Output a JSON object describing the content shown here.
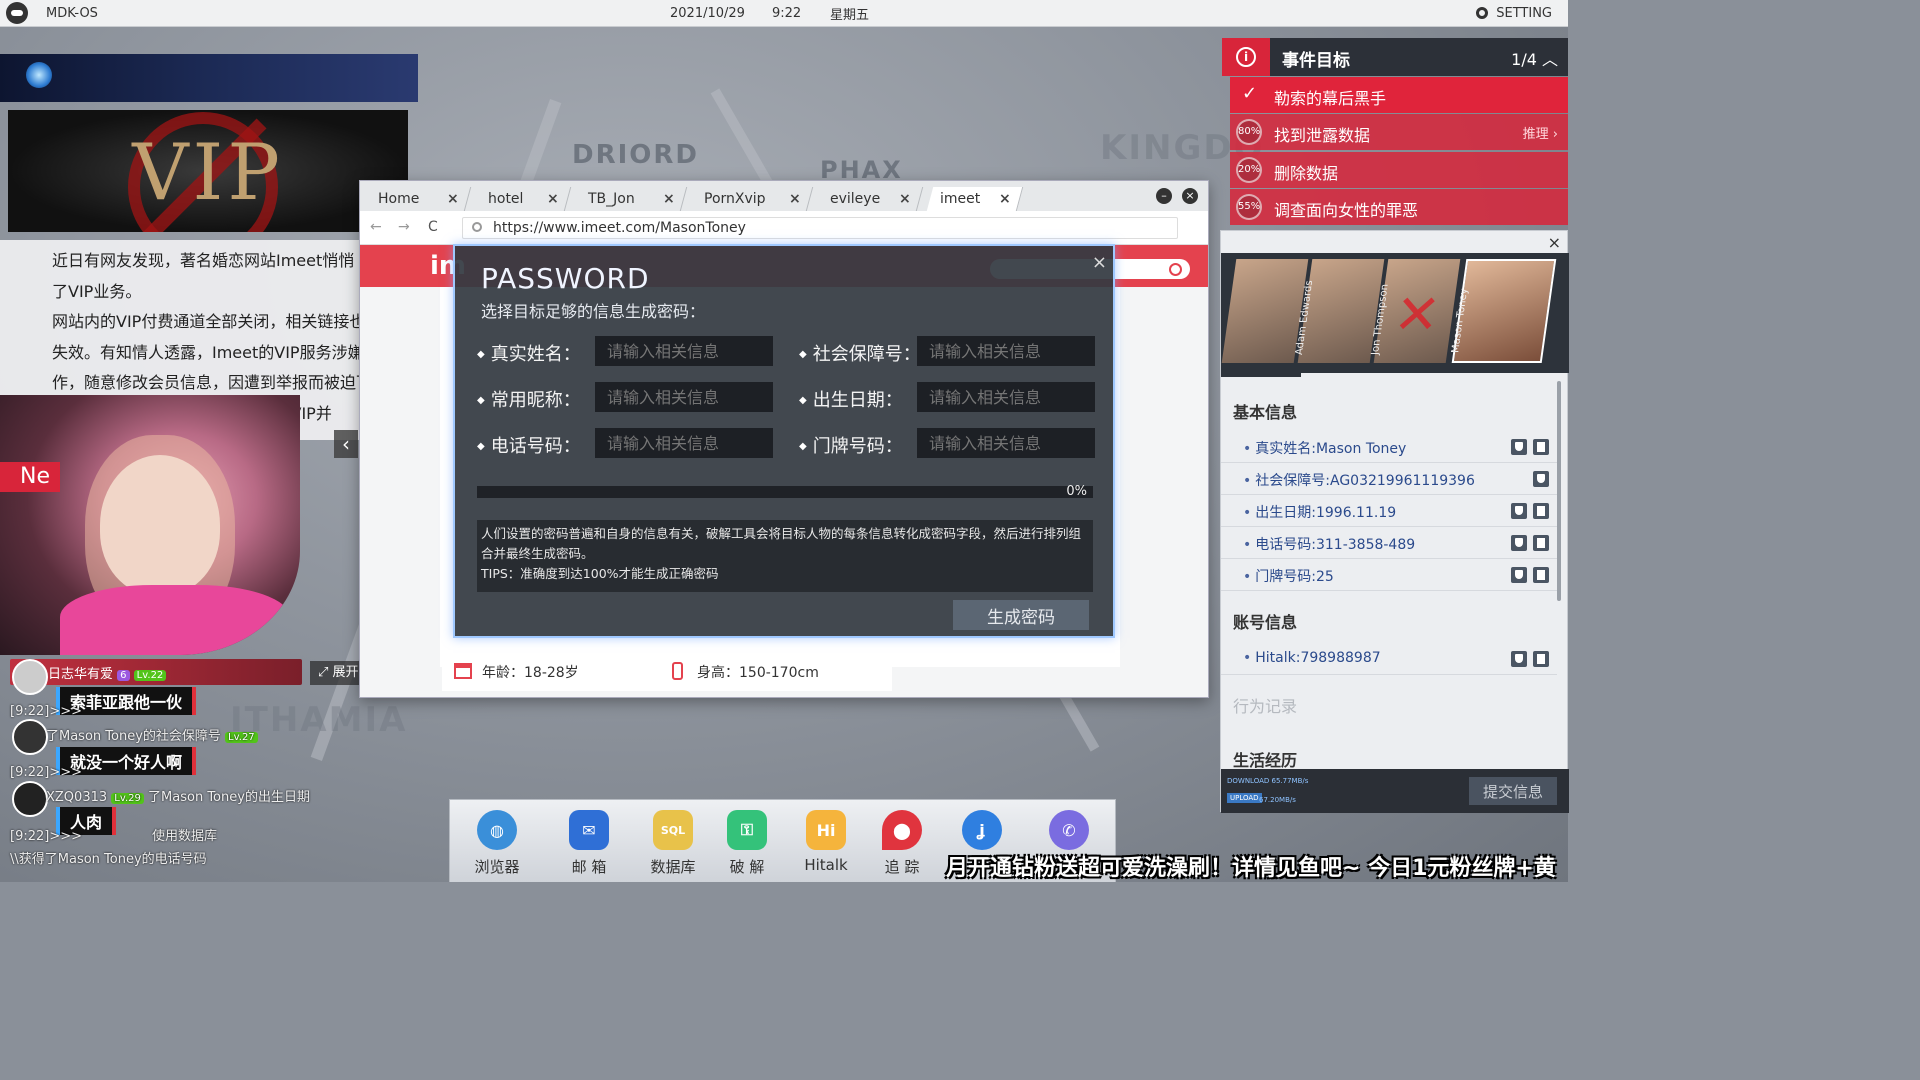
{
  "topbar": {
    "os": "MDK-OS",
    "date": "2021/10/29",
    "time": "9:22",
    "weekday": "星期五",
    "setting": "SETTING"
  },
  "map_labels": [
    "DRIORD",
    "PHAX",
    "KINGDO",
    "ITHAMIA"
  ],
  "article": {
    "banner": "VIP",
    "lines": [
      "近日有网友发现，著名婚恋网站Imeet悄悄",
      "了VIP业务。",
      "网站内的VIP付费通道全部关闭，相关链接也",
      "失效。有知情人透露，Imeet的VIP服务涉嫌违规",
      "作，随意修改会员信息，因遭到举报而被迫下线",
      "记者拨打了......电话，客服称关闭VIP并"
    ],
    "news_tag": "Ne"
  },
  "chat": {
    "top_name": "日志华有爱",
    "expand": "展开",
    "badge1": "6",
    "badge2": "Lv.22",
    "bubble1": "索菲亚跟他一伙",
    "bubble2": "就没一个好人啊",
    "bubble3": "人肉",
    "line1": "[9:22]>>>",
    "line1b": "了Mason Toney的社会保障号",
    "line1_lv": "Lv.27",
    "line2": "[9:22]>>>",
    "line2b": "了Mason Toney的出生日期",
    "line2_tag": "XZQ0313",
    "line2_lv": "Lv.29",
    "line3": "[9:22]>>>",
    "line3b": "使用数据库",
    "line4": "\\\\获得了Mason Toney的电话号码"
  },
  "browser": {
    "tabs": [
      {
        "label": "Home",
        "close": "×"
      },
      {
        "label": "hotel",
        "close": "×"
      },
      {
        "label": "TB_Jon",
        "close": "×"
      },
      {
        "label": "PornXvip",
        "close": "×"
      },
      {
        "label": "evileye",
        "close": "×"
      },
      {
        "label": "imeet",
        "close": "×"
      }
    ],
    "url": "https://www.imeet.com/MasonToney",
    "nav_back": "←",
    "nav_forward": "→",
    "nav_reload": "C",
    "minimize": "–",
    "close": "×",
    "site_logo": "im",
    "age_label": "年龄：18-28岁",
    "height_label": "身高：150-170cm"
  },
  "password_modal": {
    "title": "PASSWORD",
    "subtitle": "选择目标足够的信息生成密码：",
    "close": "×",
    "fields": [
      {
        "label": "真实姓名：",
        "placeholder": "请输入相关信息"
      },
      {
        "label": "社会保障号：",
        "placeholder": "请输入相关信息"
      },
      {
        "label": "常用昵称：",
        "placeholder": "请输入相关信息"
      },
      {
        "label": "出生日期：",
        "placeholder": "请输入相关信息"
      },
      {
        "label": "电话号码：",
        "placeholder": "请输入相关信息"
      },
      {
        "label": "门牌号码：",
        "placeholder": "请输入相关信息"
      }
    ],
    "progress": 0,
    "progress_text": "0%",
    "description": "人们设置的密码普遍和自身的信息有关，破解工具会将目标人物的每条信息转化成密码字段，然后进行排列组合并最终生成密码。",
    "tips": "TIPS：准确度到达100%才能生成正确密码",
    "generate": "生成密码"
  },
  "events": {
    "title": "事件目标",
    "count": "1/4",
    "info_icon": "i",
    "items": [
      {
        "label": "勒索的幕后黑手",
        "status": "done",
        "mark": "✓"
      },
      {
        "label": "找到泄露数据",
        "pct": "80%",
        "extra": "推理 ›"
      },
      {
        "label": "删除数据",
        "pct": "20%"
      },
      {
        "label": "调查面向女性的罪恶",
        "pct": "55%"
      }
    ]
  },
  "info_panel": {
    "close": "×",
    "portraits": [
      "Adam Edwards",
      "Jon Thompson",
      "Mason Toney"
    ],
    "basic_title": "基本信息",
    "basic": [
      "真实姓名:Mason Toney",
      "社会保障号:AG03219961119396",
      "出生日期:1996.11.19",
      "电话号码:311-3858-489",
      "门牌号码:25"
    ],
    "account_title": "账号信息",
    "accounts": [
      "Hitalk:798988987"
    ],
    "behavior_title": "行为记录",
    "life_title": "生活经历",
    "download": "DOWNLOAD 65.77MB/s",
    "upload": "UPLOAD",
    "upload_speed": "67.20MB/s",
    "submit": "提交信息"
  },
  "dock": [
    {
      "label": "浏览器",
      "icon": "globe-icon",
      "color": "#3a8fd9",
      "glyph": "◍"
    },
    {
      "label": "邮 箱",
      "icon": "mail-icon",
      "color": "#2f6fd6",
      "glyph": "✉"
    },
    {
      "label": "数据库",
      "icon": "sql-icon",
      "color": "#e8c24a",
      "glyph": "SQL"
    },
    {
      "label": "破 解",
      "icon": "key-icon",
      "color": "#34c27a",
      "glyph": "⚿"
    },
    {
      "label": "Hitalk",
      "icon": "hitalk-icon",
      "color": "#f5b43c",
      "glyph": "Hi"
    },
    {
      "label": "追 踪",
      "icon": "pin-icon",
      "color": "#e0343e",
      "glyph": "⬤"
    },
    {
      "label": "",
      "icon": "hook-icon",
      "color": "#2f7fe0",
      "glyph": "ʝ"
    },
    {
      "label": "",
      "icon": "phone-icon",
      "color": "#7a6ce0",
      "glyph": "✆"
    }
  ],
  "danmaku": "月开通钻粉送超可爱洗澡刷！详情见鱼吧~ 今日1元粉丝牌+黄"
}
